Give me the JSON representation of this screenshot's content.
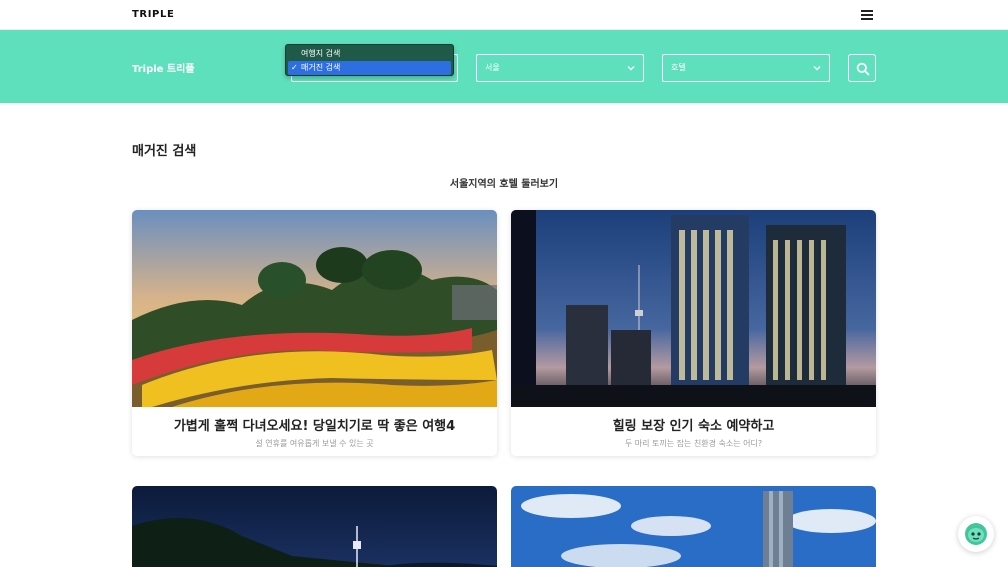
{
  "header": {
    "brand": "TRIPLE",
    "menu_icon": "hamburger-icon"
  },
  "search": {
    "band_title": "Triple 트리플",
    "dropdown_options": [
      {
        "label": "여행지 검색",
        "selected": false
      },
      {
        "label": "매거진 검색",
        "selected": true
      }
    ],
    "region_value": "서울",
    "category_value": "호텔",
    "search_icon": "search-icon",
    "accent_color": "#5fe0bd"
  },
  "main": {
    "heading": "매거진 검색",
    "section_title": "서울지역의 호텔 둘러보기",
    "cards": [
      {
        "title": "가볍게 훌쩍 다녀오세요! 당일치기로 딱 좋은 여행4",
        "subtitle": "설 연휴를 여유롭게 보낼 수 있는 곳"
      },
      {
        "title": "힐링 보장 인기 숙소 예약하고",
        "subtitle": "두 마리 토끼는 잡는 친환경 숙소는 어디?"
      }
    ]
  },
  "chatbot_icon": "chatbot-icon"
}
